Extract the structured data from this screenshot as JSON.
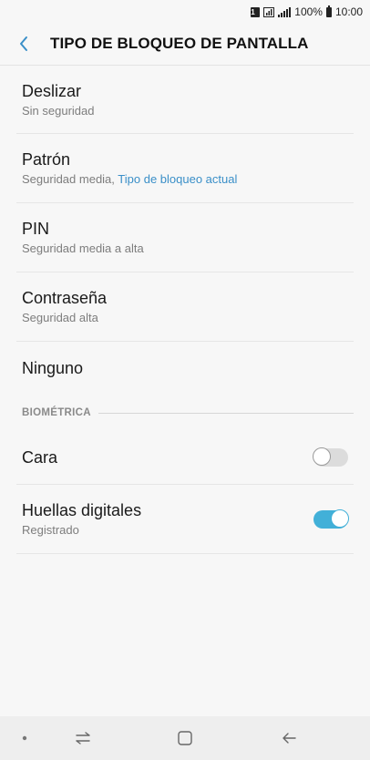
{
  "status_bar": {
    "sim_label": "1",
    "battery_text": "100%",
    "time": "10:00"
  },
  "header": {
    "back_icon": "chevron-left-icon",
    "title": "TIPO DE BLOQUEO DE PANTALLA"
  },
  "lock_options": [
    {
      "title": "Deslizar",
      "subtitle": "Sin seguridad"
    },
    {
      "title": "Patrón",
      "subtitle": "Seguridad media,",
      "subtitle_accent": "Tipo de bloqueo actual"
    },
    {
      "title": "PIN",
      "subtitle": "Seguridad media a alta"
    },
    {
      "title": "Contraseña",
      "subtitle": "Seguridad alta"
    },
    {
      "title": "Ninguno"
    }
  ],
  "biometric": {
    "section_label": "BIOMÉTRICA",
    "items": [
      {
        "title": "Cara",
        "toggle_on": false
      },
      {
        "title": "Huellas digitales",
        "subtitle": "Registrado",
        "toggle_on": true
      }
    ]
  },
  "colors": {
    "accent": "#3a8fc8",
    "toggle_on": "#42b0d8",
    "background": "#f7f7f7"
  }
}
